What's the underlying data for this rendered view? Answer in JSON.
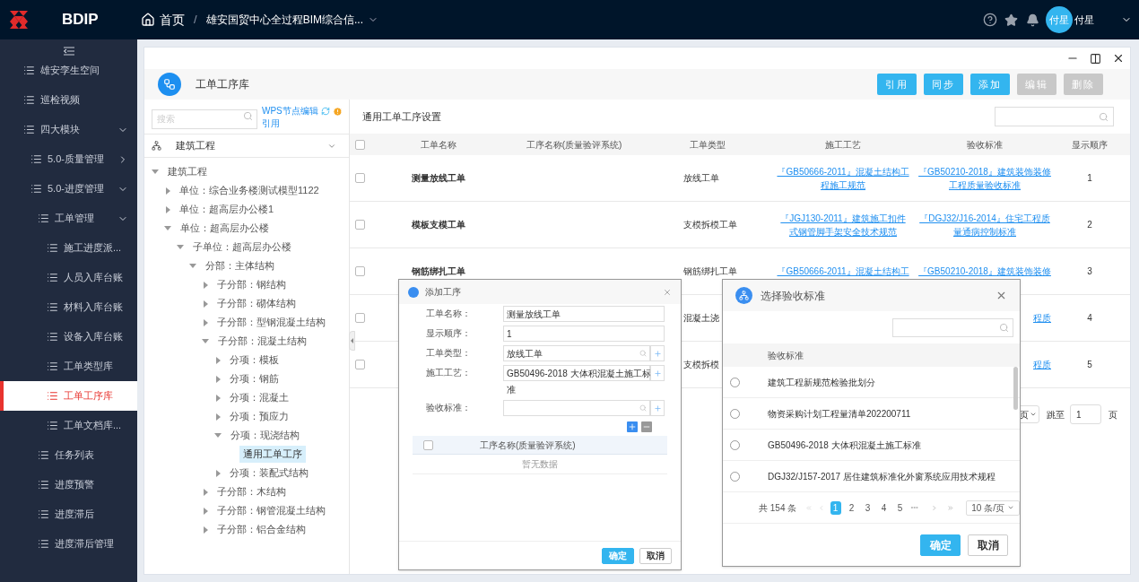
{
  "app": {
    "logo": "BDIP"
  },
  "breadcrumb_separator": "/",
  "breadcrumb": [
    {
      "label": "首页",
      "kind": "home"
    },
    {
      "label": "雄安国贸中心全过程BIM综合信...",
      "kind": "dropdown"
    }
  ],
  "user": {
    "avatar": "付星",
    "name": "付星"
  },
  "sidebar": {
    "items": [
      {
        "label": "雄安孪生空间",
        "selected": false
      },
      {
        "label": "巡检视频",
        "selected": false
      },
      {
        "label": "四大模块",
        "selected": false,
        "expanded": true,
        "children": [
          {
            "label": "5.0-质量管理",
            "selected": false,
            "expanded": false
          },
          {
            "label": "5.0-进度管理",
            "selected": false,
            "expanded": true,
            "children": [
              {
                "label": "工单管理",
                "selected": false,
                "expanded": true,
                "children": [
                  {
                    "label": "施工进度派...",
                    "selected": false
                  },
                  {
                    "label": "人员入库台账",
                    "selected": false
                  },
                  {
                    "label": "材料入库台账",
                    "selected": false
                  },
                  {
                    "label": "设备入库台账",
                    "selected": false
                  },
                  {
                    "label": "工单类型库",
                    "selected": false
                  },
                  {
                    "label": "工单工序库",
                    "selected": true
                  },
                  {
                    "label": "工单文档库...",
                    "selected": false
                  }
                ]
              },
              {
                "label": "任务列表",
                "selected": false
              },
              {
                "label": "进度预警",
                "selected": false
              },
              {
                "label": "进度滞后",
                "selected": false
              },
              {
                "label": "进度滞后管理",
                "selected": false
              }
            ]
          }
        ]
      }
    ]
  },
  "page": {
    "title": "工单工序库",
    "buttons": [
      {
        "label": "引用",
        "disabled": false
      },
      {
        "label": "同步",
        "disabled": false
      },
      {
        "label": "添加",
        "disabled": false
      },
      {
        "label": "编辑",
        "disabled": true
      },
      {
        "label": "删除",
        "disabled": true
      }
    ]
  },
  "tree_panel": {
    "search_placeholder": "搜索",
    "links": [
      "WPS节点编辑",
      "引用"
    ],
    "select": "建筑工程",
    "tree": [
      {
        "label": "建筑工程",
        "selected": false,
        "expanded": true,
        "children": [
          {
            "label": "单位：综合业务楼测试模型1122",
            "selected": false,
            "expanded": false
          },
          {
            "label": "单位：超高层办公楼1",
            "selected": false,
            "expanded": false
          },
          {
            "label": "单位：超高层办公楼",
            "selected": false,
            "expanded": true,
            "children": [
              {
                "label": "子单位：超高层办公楼",
                "selected": false,
                "expanded": true,
                "children": [
                  {
                    "label": "分部：主体结构",
                    "selected": false,
                    "expanded": true,
                    "children": [
                      {
                        "label": "子分部：钢结构",
                        "selected": false,
                        "expanded": false
                      },
                      {
                        "label": "子分部：砌体结构",
                        "selected": false,
                        "expanded": false
                      },
                      {
                        "label": "子分部：型钢混凝土结构",
                        "selected": false,
                        "expanded": false
                      },
                      {
                        "label": "子分部：混凝土结构",
                        "selected": false,
                        "expanded": true,
                        "children": [
                          {
                            "label": "分项：模板",
                            "selected": false,
                            "expanded": false
                          },
                          {
                            "label": "分项：钢筋",
                            "selected": false,
                            "expanded": false
                          },
                          {
                            "label": "分项：混凝土",
                            "selected": false,
                            "expanded": false
                          },
                          {
                            "label": "分项：预应力",
                            "selected": false,
                            "expanded": false
                          },
                          {
                            "label": "分项：现浇结构",
                            "selected": false,
                            "expanded": true,
                            "children": [
                              {
                                "label": "通用工单工序",
                                "selected": true
                              }
                            ]
                          },
                          {
                            "label": "分项：装配式结构",
                            "selected": false,
                            "expanded": false
                          }
                        ]
                      },
                      {
                        "label": "子分部：木结构",
                        "selected": false,
                        "expanded": false
                      },
                      {
                        "label": "子分部：钢管混凝土结构",
                        "selected": false,
                        "expanded": false
                      },
                      {
                        "label": "子分部：铝合金结构",
                        "selected": false,
                        "expanded": false
                      }
                    ]
                  }
                ]
              }
            ]
          }
        ]
      }
    ]
  },
  "table": {
    "title": "通用工单工序设置",
    "header_checked": false,
    "columns": [
      "工单名称",
      "工序名称(质量验评系统)",
      "工单类型",
      "施工工艺",
      "验收标准",
      "显示顺序"
    ],
    "rows": [
      {
        "checked": false,
        "name": "测量放线工单",
        "type": "放线工单",
        "craft": "『GB50666-2011』混凝土结构工程施工规范",
        "standard": "『GB50210-2018』建筑装饰装修工程质量验收标准",
        "order": "1"
      },
      {
        "checked": false,
        "name": "模板支模工单",
        "type": "支模拆模工单",
        "craft": "『JGJ130-2011』建筑施工扣件式钢管脚手架安全技术规范",
        "standard": "『DGJ32/J16-2014』住宅工程质量通病控制标准",
        "order": "2"
      },
      {
        "checked": false,
        "name": "钢筋绑扎工单",
        "type": "钢筋绑扎工单",
        "craft": "『GB50666-2011』混凝土结构工",
        "standard": "『GB50210-2018』建筑装饰装修",
        "order": "3"
      },
      {
        "checked": false,
        "type": "混凝土浇",
        "standard": "程质",
        "order": "4",
        "covered": true
      },
      {
        "checked": false,
        "type": "支模拆模",
        "standard": "程质",
        "order": "5",
        "covered": true
      }
    ],
    "pagination": {
      "size_fragment": "页",
      "jump_label": "跳至",
      "page": "1",
      "unit": "页"
    }
  },
  "dialog_add": {
    "title": "添加工序",
    "fields": [
      {
        "label": "工单名称：",
        "value": "测量放线工单",
        "kind": "text"
      },
      {
        "label": "显示顺序：",
        "value": "1",
        "kind": "text"
      },
      {
        "label": "工单类型：",
        "value": "放线工单",
        "kind": "lookup"
      },
      {
        "label": "施工工艺：",
        "value": "GB50496-2018 大体积混凝土施工标",
        "overflow": "准",
        "kind": "lookup"
      },
      {
        "label": "验收标准：",
        "kind": "lookup"
      }
    ],
    "list_header": "工序名称(质量验评系统)",
    "header_checked": false,
    "empty": "暂无数据",
    "buttons": [
      {
        "label": "确定",
        "kind": "primary"
      },
      {
        "label": "取消",
        "kind": "default"
      }
    ]
  },
  "dialog_standard": {
    "title": "选择验收标准",
    "column": "验收标准",
    "rows": [
      {
        "label": "建筑工程新规范检验批划分",
        "selected": false
      },
      {
        "label": "物资采购计划工程量清单202200711",
        "selected": false
      },
      {
        "label": "GB50496-2018 大体积混凝土施工标准",
        "selected": false
      },
      {
        "label": "DGJ32/J157-2017 居住建筑标准化外窗系统应用技术规程",
        "selected": false
      }
    ],
    "total": "共 154 条",
    "pages": [
      {
        "label": "1",
        "selected": true
      },
      {
        "label": "2",
        "selected": false
      },
      {
        "label": "3",
        "selected": false
      },
      {
        "label": "4",
        "selected": false
      },
      {
        "label": "5",
        "selected": false
      }
    ],
    "ellipsis": "•••",
    "page_size": "10 条/页",
    "buttons": [
      {
        "label": "确定",
        "kind": "primary"
      },
      {
        "label": "取消",
        "kind": "default"
      }
    ]
  }
}
